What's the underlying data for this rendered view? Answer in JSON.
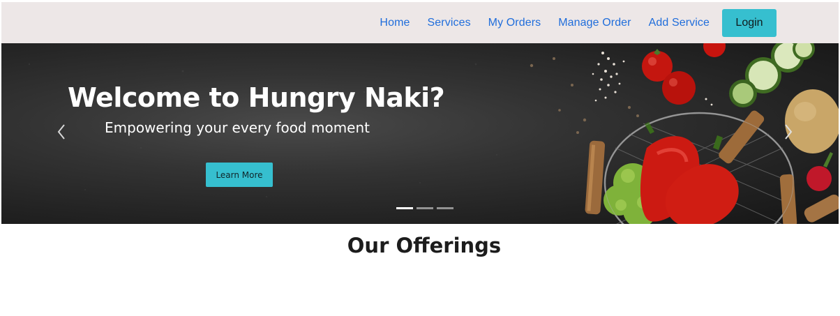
{
  "nav": {
    "links": [
      "Home",
      "Services",
      "My Orders",
      "Manage Order",
      "Add Service"
    ],
    "login_label": "Login"
  },
  "carousel": {
    "title": "Welcome to Hungry Naki?",
    "subtitle": "Empowering your every food moment",
    "button_label": "Learn More",
    "slide_count": 3,
    "active_index": 0
  },
  "offerings": {
    "title": "Our Offerings"
  },
  "colors": {
    "navbar_bg": "#ede7e7",
    "link": "#1f6ddb",
    "accent": "#36bfcf"
  }
}
